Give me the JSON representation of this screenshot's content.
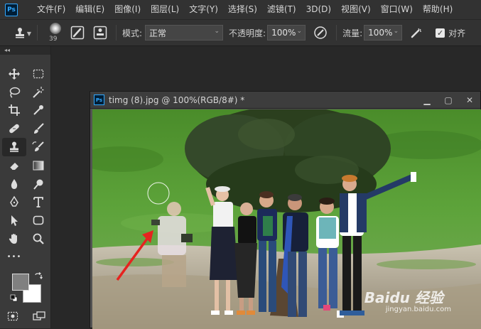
{
  "app": {
    "logo": "Ps"
  },
  "menu": [
    "文件(F)",
    "编辑(E)",
    "图像(I)",
    "图层(L)",
    "文字(Y)",
    "选择(S)",
    "滤镜(T)",
    "3D(D)",
    "视图(V)",
    "窗口(W)",
    "帮助(H)"
  ],
  "options": {
    "brush_size": "39",
    "mode_label": "模式:",
    "mode_value": "正常",
    "opacity_label": "不透明度:",
    "opacity_value": "100%",
    "flow_label": "流量:",
    "flow_value": "100%",
    "align_label": "对齐",
    "align_checked": true
  },
  "toolbar": {
    "collapse": "◂◂",
    "tools": [
      "move-icon",
      "marquee-icon",
      "lasso-icon",
      "magic-wand-icon",
      "crop-icon",
      "eyedropper-icon",
      "healing-brush-icon",
      "brush-icon",
      "clone-stamp-icon",
      "history-brush-icon",
      "eraser-icon",
      "gradient-icon",
      "blur-icon",
      "dodge-icon",
      "pen-icon",
      "type-icon",
      "path-selection-icon",
      "rectangle-icon",
      "hand-icon",
      "zoom-icon"
    ],
    "more": "•••",
    "foreground_color": "#808080",
    "background_color": "#ffffff"
  },
  "document": {
    "logo": "Ps",
    "title": "timg (8).jpg @ 100%(RGB/8#) *",
    "minimize": "▁",
    "restore": "▢",
    "close": "✕"
  },
  "watermark": {
    "main": "Baidu 经验",
    "sub": "jingyan.baidu.com"
  }
}
